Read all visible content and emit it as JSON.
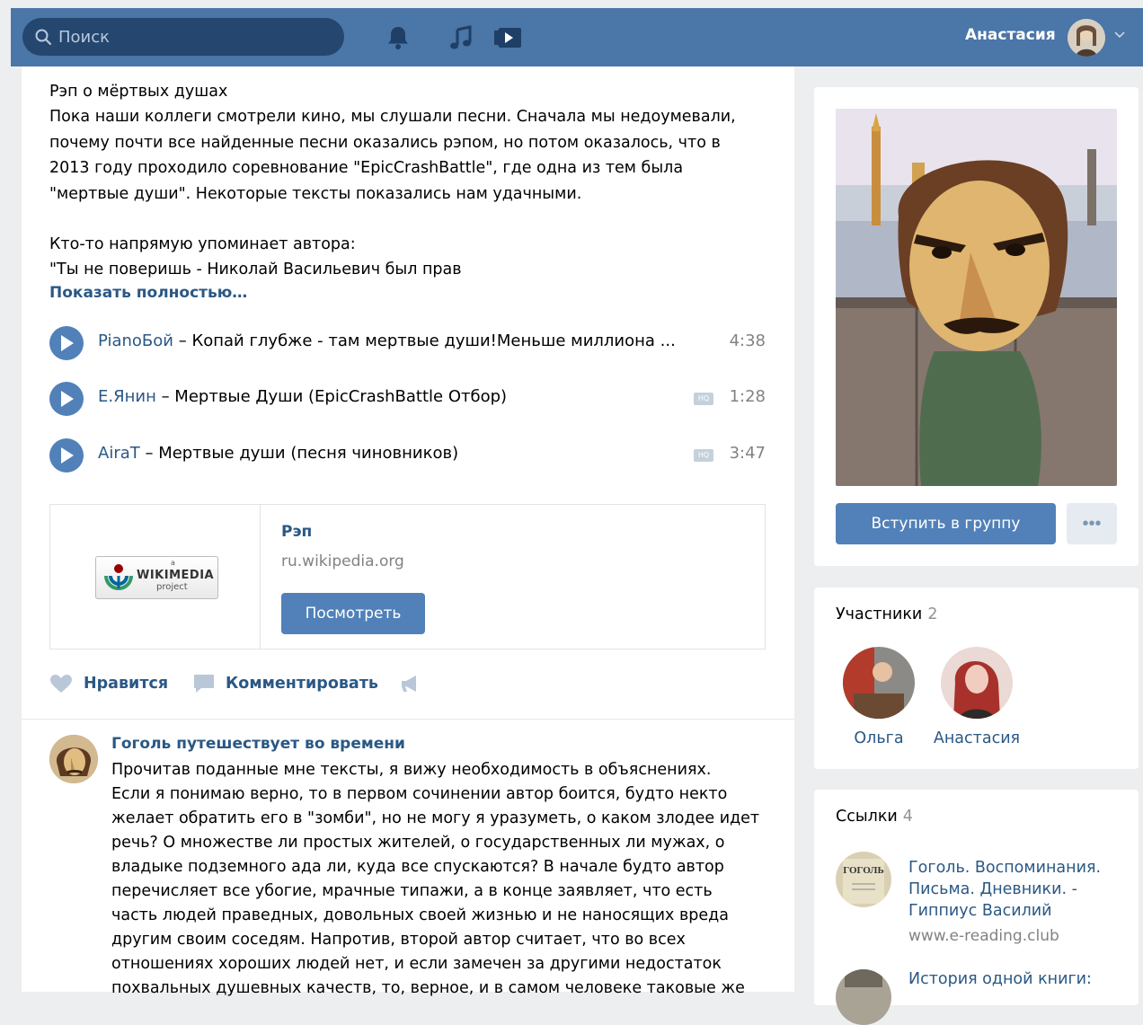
{
  "header": {
    "search_placeholder": "Поиск",
    "user_name": "Анастасия",
    "icons": [
      "bell-icon",
      "music-icon",
      "video-icon"
    ],
    "brand_color": "#4a76a8"
  },
  "post": {
    "paragraph1": "Рэп о мёртвых душах\nПока наши коллеги смотрели кино, мы слушали песни. Сначала мы недоумевали,\nпочему почти все найденные песни оказались рэпом, но потом оказалось, что в\n2013 году проходило соревнование \"EpicCrashBattle\", где одна из тем была\n\"мертвые души\". Некоторые тексты показались нам удачными.",
    "paragraph2": "Кто-то напрямую упоминает автора:\n\"Ты не поверишь - Николай Васильевич был прав",
    "show_more": "Показать полностью…",
    "tracks": [
      {
        "artist": "PianoБой",
        "sep": " – ",
        "title": "Копай глубже - там мертвые души!Меньше миллиона ...",
        "duration": "4:38",
        "hq": false
      },
      {
        "artist": "Е.Янин",
        "sep": " – ",
        "title": "Мертвые Души (EpicCrashBattle Отбор)",
        "duration": "1:28",
        "hq": true
      },
      {
        "artist": "AiraT",
        "sep": " – ",
        "title": "Мертвые души (песня чиновников)",
        "duration": "3:47",
        "hq": true
      }
    ],
    "hq_label": "HQ",
    "link": {
      "logo_text": "WIKIMEDIA",
      "logo_sub": "project",
      "logo_a": "a",
      "title": "Рэп",
      "domain": "ru.wikipedia.org",
      "button": "Посмотреть"
    },
    "actions": {
      "like": "Нравится",
      "comment": "Комментировать"
    }
  },
  "comment": {
    "author": "Гоголь путешествует во времени",
    "text": "Прочитав поданные мне тексты, я вижу необходимость в объяснениях.\nЕсли я понимаю верно, то в первом сочинении автор боится, будто некто\nжелает обратить его в \"зомби\", но не могу я уразуметь, о каком злодее идет\nречь? О множестве ли простых жителей, о государственных ли мужах, о\nвладыке подземного ада ли, куда все спускаются? В начале будто автор\nперечисляет все убогие, мрачные типажи, а в конце заявляет, что есть\nчасть людей праведных, довольных своей жизнью и не наносящих вреда\nдругим своим соседям. Напротив, второй автор считает, что во всех\nотношениях хороших людей нет, и если замечен за другими недостаток\nпохвальных душевных качеств, то, верное, и в самом человеке таковые же"
  },
  "sidebar": {
    "join_button": "Вступить в группу",
    "more_button": "•••",
    "members": {
      "title": "Участники",
      "count": "2",
      "items": [
        {
          "name": "Ольга"
        },
        {
          "name": "Анастасия"
        }
      ]
    },
    "links": {
      "title": "Ссылки",
      "count": "4",
      "items": [
        {
          "title": "Гоголь. Воспоминания. Письма. Дневники. - Гиппиус Василий",
          "url": "www.e-reading.club",
          "thumb_text": "ГОГОЛЬ"
        },
        {
          "title": "История одной книги:",
          "url": ""
        }
      ]
    }
  }
}
